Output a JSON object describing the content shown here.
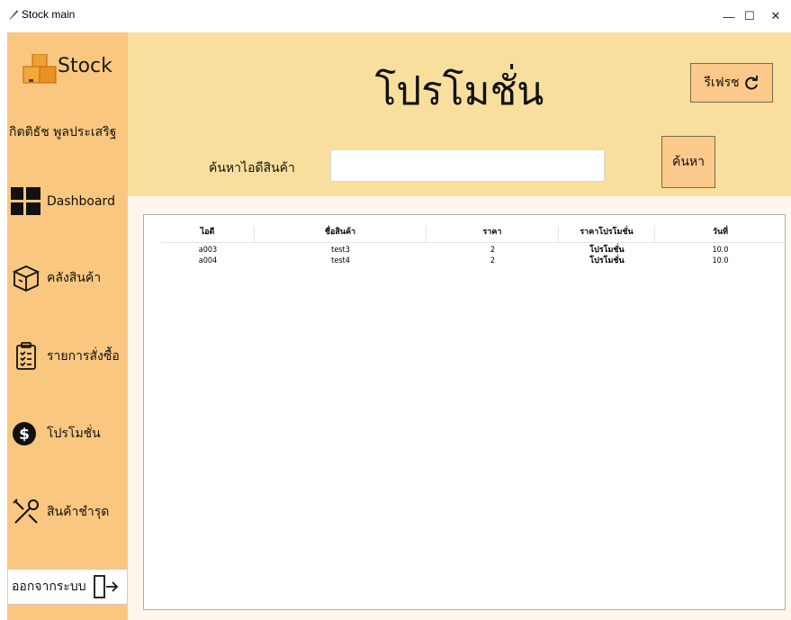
{
  "window": {
    "title": "Stock main",
    "minimize": "—",
    "maximize": "☐",
    "close": "✕"
  },
  "sidebar": {
    "logo_text": "Stock",
    "username": "กิตติธัช พูลประเสริฐ",
    "items": [
      {
        "label": "Dashboard",
        "icon": "dashboard-grid-icon"
      },
      {
        "label": "คลังสินค้า",
        "icon": "box-icon"
      },
      {
        "label": "รายการสั่งซื้อ",
        "icon": "clipboard-icon"
      },
      {
        "label": "โปรโมชั่น",
        "icon": "dollar-icon"
      },
      {
        "label": "สินค้าชำรุด",
        "icon": "tools-icon"
      }
    ],
    "logout_label": "ออกจากระบบ"
  },
  "header": {
    "title": "โปรโมชั่น",
    "refresh_label": "รีเฟรช",
    "search_label": "ค้นหาไอดีสินค้า",
    "search_value": "",
    "search_button": "ค้นหา"
  },
  "table": {
    "columns": [
      "ไอดี",
      "ชื่อสินค้า",
      "ราคา",
      "ราคาโปรโมชั่น",
      "วันที่"
    ],
    "rows": [
      [
        "a003",
        "test3",
        "2",
        "โปรโมชั่น",
        "10.0"
      ],
      [
        "a004",
        "test4",
        "2",
        "โปรโมชั่น",
        "10.0"
      ]
    ]
  },
  "colors": {
    "sidebar": "#f9c77f",
    "header": "#f9df9d",
    "button": "#fbc98a",
    "content": "#fff7ee"
  }
}
